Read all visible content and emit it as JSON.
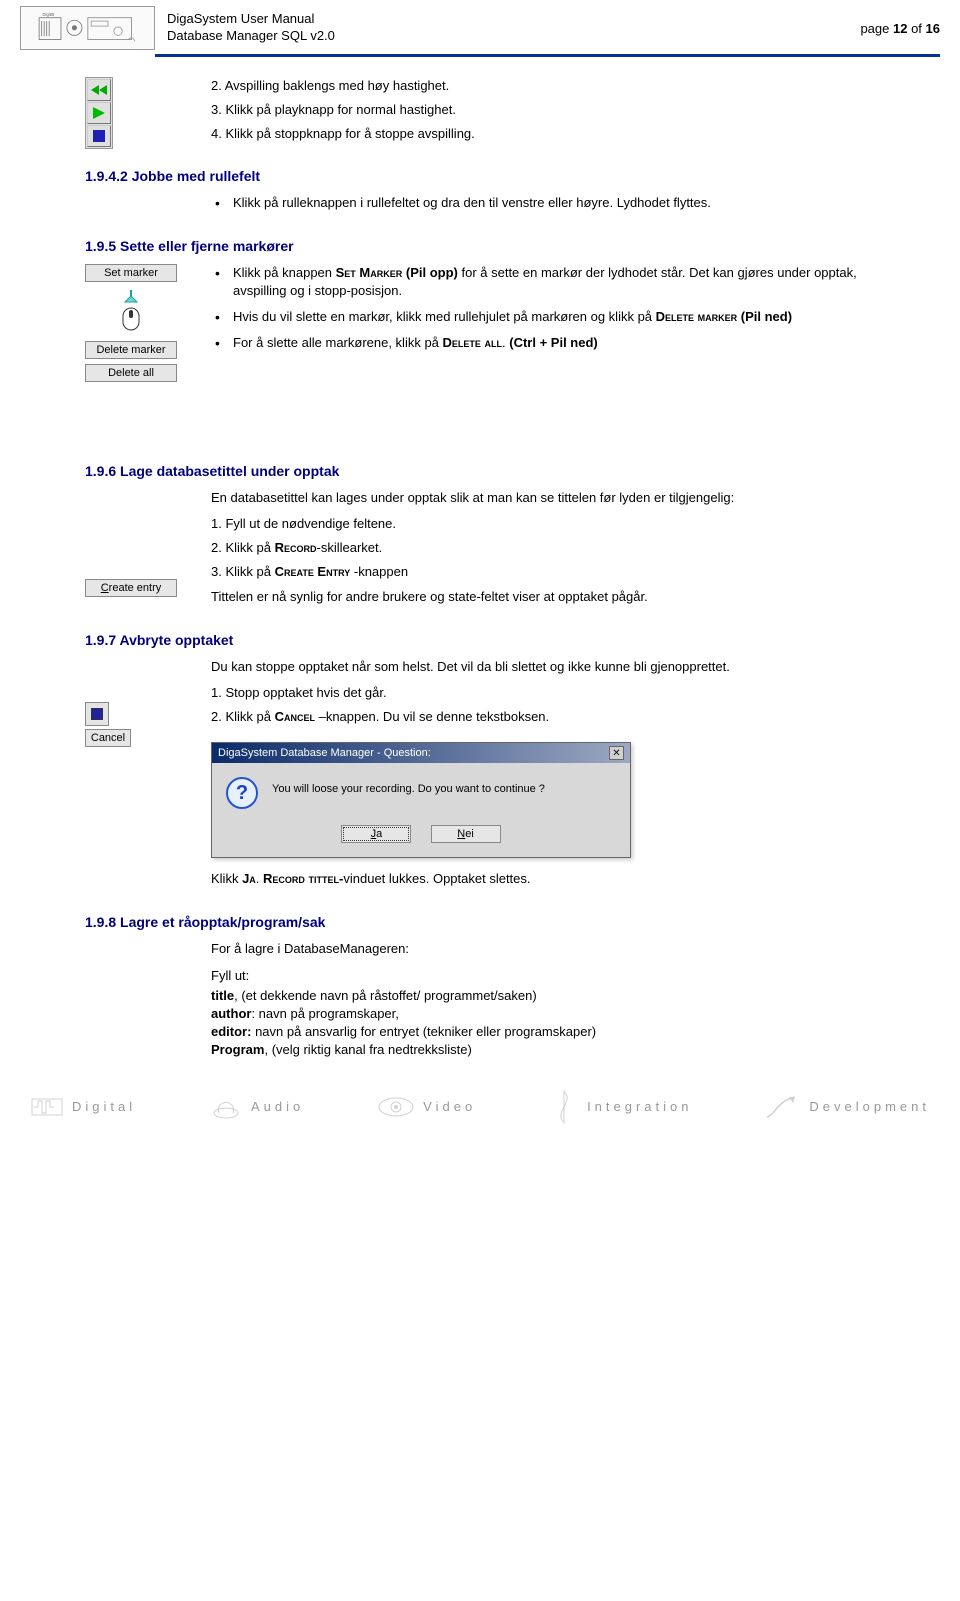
{
  "header": {
    "title_line1": "DigaSystem User Manual",
    "title_line2": "Database Manager SQL v2.0",
    "page_label": "page ",
    "page_num": "12",
    "page_of": " of ",
    "page_total": "16"
  },
  "sec0": {
    "item2": "2. Avspilling baklengs med høy hastighet.",
    "item3": "3. Klikk på playknapp for normal hastighet.",
    "item4": "4. Klikk på stoppknapp for å stoppe avspilling."
  },
  "sec_1942": {
    "heading": "1.9.4.2 Jobbe med rullefelt",
    "bullet1": "Klikk på rulleknappen i rullefeltet og dra den til venstre eller høyre. Lydhodet flyttes."
  },
  "sec_195": {
    "heading": "1.9.5 Sette eller fjerne markører",
    "btn_set": "Set marker",
    "btn_delete_marker": "Delete marker",
    "btn_delete_all": "Delete all",
    "b1_pre": "Klikk på knappen ",
    "b1_sc": "Set Marker",
    "b1_bold": " (Pil opp)",
    "b1_post": " for å sette en markør der lydhodet står. Det kan gjøres under opptak, avspilling og i stopp-posisjon.",
    "b2_pre": "Hvis du vil slette en markør, klikk med rullehjulet på markøren og klikk på ",
    "b2_sc1": "Delete marker",
    "b2_bold": " (Pil ned)",
    "b3_pre": "For å slette alle markørene, klikk på ",
    "b3_sc": "Delete all",
    "b3_post": ". ",
    "b3_bold": "(Ctrl  + Pil ned)"
  },
  "sec_196": {
    "heading": "1.9.6 Lage databasetittel under opptak",
    "btn_create": "Create entry",
    "p1": "En databasetittel kan  lages under opptak slik at man kan se tittelen før lyden er tilgjengelig:",
    "i1": "1. Fyll ut de nødvendige feltene.",
    "i2_pre": "2. Klikk på ",
    "i2_sc": "Record",
    "i2_post": "-skillearket.",
    "i3_pre": "3. Klikk på ",
    "i3_sc": "Create Entry",
    "i3_post": " -knappen",
    "p2": "Tittelen er nå synlig for andre brukere og state-feltet viser at opptaket pågår."
  },
  "sec_197": {
    "heading": "1.9.7 Avbryte opptaket",
    "btn_cancel": "Cancel",
    "p1": "Du kan stoppe opptaket når som helst. Det vil da bli slettet og ikke kunne bli gjenopprettet.",
    "i1": "1. Stopp opptaket hvis det går.",
    "i2_pre": "2. Klikk på ",
    "i2_sc": "Cancel",
    "i2_post": " –knappen. Du vil se denne tekstboksen.",
    "dialog_title": "DigaSystem Database Manager - Question:",
    "dialog_msg": "You will loose your recording. Do you want to continue ?",
    "dialog_yes": "Ja",
    "dialog_no": "Nei",
    "p3_pre": "Klikk ",
    "p3_sc1": "Ja",
    "p3_mid": ". ",
    "p3_sc2": "Record tittel-",
    "p3_post": "vinduet lukkes. Opptaket slettes."
  },
  "sec_198": {
    "heading": "1.9.8 Lagre et råopptak/program/sak",
    "p1": "For å lagre i DatabaseManageren:",
    "line1": "Fyll ut:",
    "l2_b": "title",
    "l2_r": ", (et dekkende navn på råstoffet/ programmet/saken)",
    "l3_b": "author",
    "l3_r": ": navn på programskaper,",
    "l4_b": "editor:",
    "l4_r": " navn på ansvarlig for entryet (tekniker eller programskaper)",
    "l5_b": "Program",
    "l5_r": ", (velg riktig kanal fra nedtrekksliste)"
  },
  "footer": {
    "digital": "Digital",
    "audio": "Audio",
    "video": "Video",
    "integration": "Integration",
    "development": "Development"
  }
}
